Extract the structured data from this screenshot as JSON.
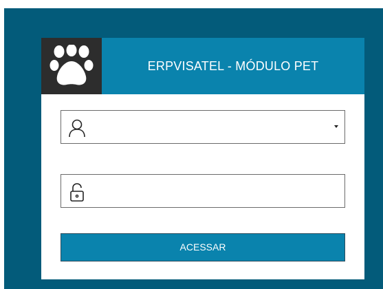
{
  "header": {
    "title": "ERPVISATEL - MÓDULO PET",
    "logo_icon": "paw-icon"
  },
  "form": {
    "user_field": {
      "icon": "user-icon",
      "value": "",
      "has_dropdown": true
    },
    "password_field": {
      "icon": "lock-icon",
      "value": ""
    },
    "submit_label": "ACESSAR"
  },
  "colors": {
    "frame": "#035b7a",
    "header": "#0a83ad",
    "logo_bg": "#2d2d2d",
    "button": "#0a83ad"
  }
}
